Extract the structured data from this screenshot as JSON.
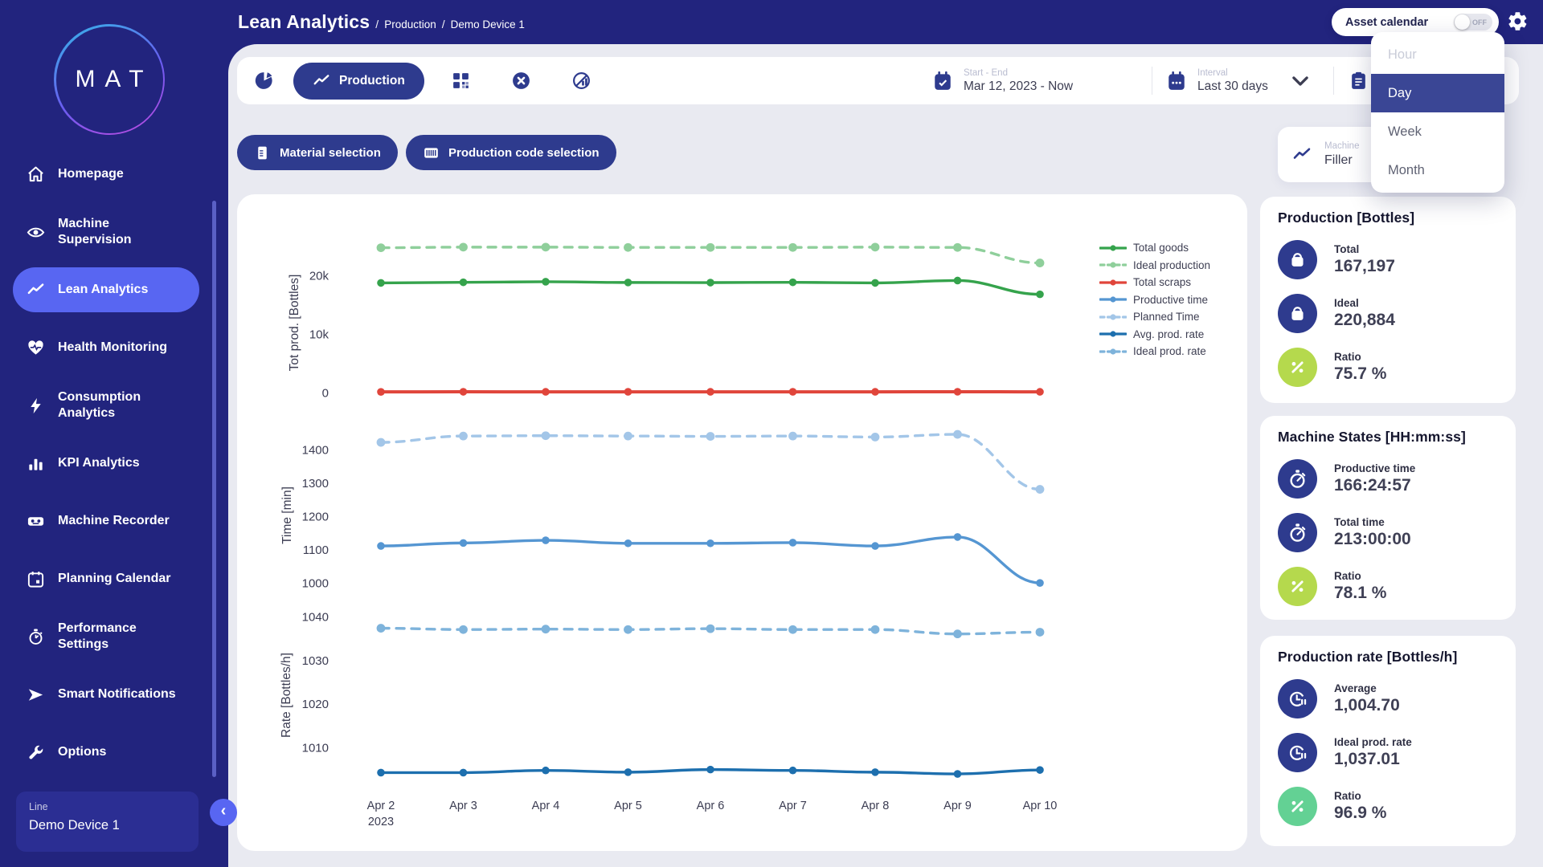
{
  "header": {
    "title": "Lean Analytics",
    "sep": "/",
    "breadcrumbs": [
      "Production",
      "Demo Device 1"
    ],
    "asset_calendar": {
      "label": "Asset calendar",
      "state": "OFF"
    }
  },
  "logo": {
    "text": "MAT"
  },
  "sidebar": {
    "items": [
      {
        "label": "Homepage",
        "icon": "home-icon",
        "active": false
      },
      {
        "label": "Machine Supervision",
        "icon": "eye-icon",
        "active": false
      },
      {
        "label": "Lean Analytics",
        "icon": "trend-icon",
        "active": true
      },
      {
        "label": "Health Monitoring",
        "icon": "heart-pulse-icon",
        "active": false
      },
      {
        "label": "Consumption Analytics",
        "icon": "bolt-icon",
        "active": false
      },
      {
        "label": "KPI Analytics",
        "icon": "bar-chart-icon",
        "active": false
      },
      {
        "label": "Machine Recorder",
        "icon": "recorder-icon",
        "active": false
      },
      {
        "label": "Planning Calendar",
        "icon": "calendar-icon",
        "active": false
      },
      {
        "label": "Performance Settings",
        "icon": "stopwatch-icon",
        "active": false
      },
      {
        "label": "Smart Notifications",
        "icon": "send-icon",
        "active": false
      },
      {
        "label": "Options",
        "icon": "wrench-icon",
        "active": false
      }
    ],
    "device_selector": {
      "label": "Line",
      "value": "Demo Device 1"
    }
  },
  "toolbar": {
    "production_label": "Production",
    "date_range": {
      "label": "Start - End",
      "value": "Mar 12, 2023 - Now"
    },
    "interval": {
      "label": "Interval",
      "value": "Last 30 days"
    }
  },
  "filters": {
    "material_button": "Material selection",
    "production_code_button": "Production code selection"
  },
  "machine_card": {
    "label": "Machine",
    "value": "Filler"
  },
  "interval_dropdown": {
    "options": [
      {
        "label": "Hour",
        "state": "disabled"
      },
      {
        "label": "Day",
        "state": "selected"
      },
      {
        "label": "Week",
        "state": "normal"
      },
      {
        "label": "Month",
        "state": "normal"
      }
    ]
  },
  "stats_panels": [
    {
      "title": "Production [Bottles]",
      "rows": [
        {
          "icon": "bag-icon",
          "icon_bg": "#2E3B8E",
          "label": "Total",
          "value": "167,197"
        },
        {
          "icon": "bag-icon",
          "icon_bg": "#2E3B8E",
          "label": "Ideal",
          "value": "220,884"
        },
        {
          "icon": "percent-icon",
          "icon_bg": "#B5D94D",
          "label": "Ratio",
          "value": "75.7 %"
        }
      ]
    },
    {
      "title": "Machine States [HH:mm:ss]",
      "rows": [
        {
          "icon": "stopwatch2-icon",
          "icon_bg": "#2E3B8E",
          "label": "Productive time",
          "value": "166:24:57"
        },
        {
          "icon": "stopwatch2-icon",
          "icon_bg": "#2E3B8E",
          "label": "Total time",
          "value": "213:00:00"
        },
        {
          "icon": "percent-icon",
          "icon_bg": "#B5D94D",
          "label": "Ratio",
          "value": "78.1 %"
        }
      ]
    },
    {
      "title": "Production rate [Bottles/h]",
      "rows": [
        {
          "icon": "rate-icon",
          "icon_bg": "#2E3B8E",
          "label": "Average",
          "value": "1,004.70"
        },
        {
          "icon": "rate-icon",
          "icon_bg": "#2E3B8E",
          "label": "Ideal prod. rate",
          "value": "1,037.01"
        },
        {
          "icon": "percent-icon",
          "icon_bg": "#63D194",
          "label": "Ratio",
          "value": "96.9 %"
        }
      ]
    }
  ],
  "chart_data": {
    "type": "line",
    "categories": [
      "Apr 2",
      "Apr 3",
      "Apr 4",
      "Apr 5",
      "Apr 6",
      "Apr 7",
      "Apr 8",
      "Apr 9",
      "Apr 10"
    ],
    "first_tick_year": "2023",
    "legend": [
      {
        "label": "Total goods",
        "color": "#35A34C",
        "dash": false
      },
      {
        "label": "Ideal production",
        "color": "#8FCF9B",
        "dash": true
      },
      {
        "label": "Total scraps",
        "color": "#E0453B",
        "dash": false
      },
      {
        "label": "Productive time",
        "color": "#5596D2",
        "dash": false
      },
      {
        "label": "Planned Time",
        "color": "#A3C6E8",
        "dash": true
      },
      {
        "label": "Avg. prod. rate",
        "color": "#1D6FAE",
        "dash": false
      },
      {
        "label": "Ideal prod. rate",
        "color": "#7EB3DB",
        "dash": true
      }
    ],
    "charts": [
      {
        "ylabel": "Tot prod. [Bottles]",
        "ylim": [
          -1200,
          27200
        ],
        "yticks": [
          {
            "v": 0,
            "label": "0"
          },
          {
            "v": 10000,
            "label": "10k"
          },
          {
            "v": 20000,
            "label": "20k"
          }
        ],
        "series": [
          {
            "name": "Ideal production",
            "color": "#8FCF9B",
            "dash": true,
            "values": [
              24850,
              24950,
              24950,
              24900,
              24900,
              24900,
              24950,
              24900,
              22250
            ]
          },
          {
            "name": "Total goods",
            "color": "#35A34C",
            "dash": false,
            "values": [
              18850,
              18950,
              19050,
              18920,
              18900,
              18950,
              18850,
              19250,
              16900
            ]
          },
          {
            "name": "Total scraps",
            "color": "#E0453B",
            "dash": false,
            "values": [
              250,
              270,
              260,
              265,
              260,
              265,
              260,
              275,
              260
            ]
          }
        ]
      },
      {
        "ylabel": "Time [min]",
        "ylim": [
          950,
          1475
        ],
        "yticks": [
          {
            "v": 1000,
            "label": "1000"
          },
          {
            "v": 1100,
            "label": "1100"
          },
          {
            "v": 1200,
            "label": "1200"
          },
          {
            "v": 1300,
            "label": "1300"
          },
          {
            "v": 1400,
            "label": "1400"
          }
        ],
        "series": [
          {
            "name": "Planned Time",
            "color": "#A3C6E8",
            "dash": true,
            "values": [
              1424,
              1443,
              1444,
              1443,
              1442,
              1443,
              1440,
              1448,
              1283
            ]
          },
          {
            "name": "Productive time",
            "color": "#5596D2",
            "dash": false,
            "values": [
              1113,
              1122,
              1130,
              1121,
              1121,
              1123,
              1113,
              1140,
              1002
            ]
          }
        ]
      },
      {
        "ylabel": "Rate [Bottles/h]",
        "ylim": [
          1000,
          1042.5
        ],
        "yticks": [
          {
            "v": 1010,
            "label": "1010"
          },
          {
            "v": 1020,
            "label": "1020"
          },
          {
            "v": 1030,
            "label": "1030"
          },
          {
            "v": 1040,
            "label": "1040"
          }
        ],
        "series": [
          {
            "name": "Ideal prod. rate",
            "color": "#7EB3DB",
            "dash": true,
            "values": [
              1037.5,
              1037.2,
              1037.3,
              1037.2,
              1037.4,
              1037.2,
              1037.2,
              1036.2,
              1036.6
            ]
          },
          {
            "name": "Avg. prod. rate",
            "color": "#1D6FAE",
            "dash": false,
            "values": [
              1004.4,
              1004.4,
              1004.9,
              1004.5,
              1005.1,
              1004.9,
              1004.5,
              1004.1,
              1005.0
            ]
          }
        ]
      }
    ]
  }
}
